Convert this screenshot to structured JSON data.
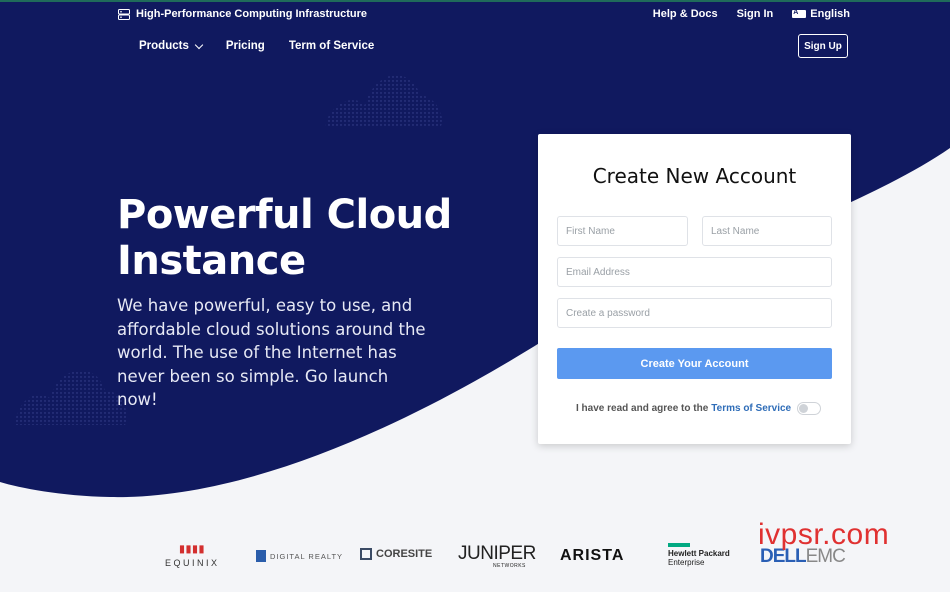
{
  "header": {
    "brand": "High-Performance Computing Infrastructure",
    "links": [
      "Help & Docs",
      "Sign In"
    ],
    "language": "English",
    "nav": [
      "Products",
      "Pricing",
      "Term of Service"
    ],
    "signup": "Sign Up"
  },
  "hero": {
    "title_line1": "Powerful Cloud",
    "title_line2": "Instance",
    "subtitle": "We have powerful, easy to use, and affordable cloud solutions around the world. The use of the Internet has never been so simple. Go launch now!"
  },
  "form": {
    "title": "Create New Account",
    "first_name_placeholder": "First Name",
    "last_name_placeholder": "Last Name",
    "email_placeholder": "Email Address",
    "password_placeholder": "Create a password",
    "submit": "Create Your Account",
    "agree_text": "I have read and agree to the",
    "terms_link": "Terms of Service"
  },
  "partners": {
    "equinix": "EQUINIX",
    "digital_realty": "DIGITAL REALTY",
    "coresite": "CORESITE",
    "juniper": "JUNIPER",
    "juniper_sub": "NETWORKS",
    "arista": "ARISTA",
    "hpe_line1": "Hewlett Packard",
    "hpe_line2": "Enterprise",
    "dell": "DELL",
    "emc": "EMC"
  },
  "watermark": "ivpsr.com",
  "colors": {
    "hero_bg": "#10195f",
    "page_bg": "#f4f5f8",
    "cta": "#5b99f0",
    "link": "#2f6db8"
  }
}
